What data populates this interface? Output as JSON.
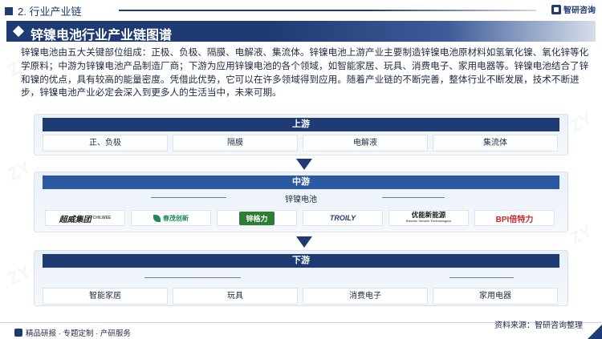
{
  "header": {
    "section": "2. 行业产业链",
    "brand": "智研咨询"
  },
  "title": "锌镍电池行业产业链图谱",
  "paragraph": "锌镍电池由五大关键部位组成：正极、负极、隔膜、电解液、集流体。锌镍电池上游产业主要制造锌镍电池原材料如氢氧化镍、氧化锌等化学原料；中游为锌镍电池产品制造厂商；下游为应用锌镍电池的各个领域，如智能家居、玩具、消费电子、家用电器等。锌镍电池结合了锌和镍的优点，具有较高的能量密度。凭借此优势，它可以在许多领域得到应用。随着产业链的不断完善，整体行业不断发展，技术不断进步，锌镍电池产业必定会深入到更多人的生活当中，未来可期。",
  "upstream": {
    "label": "上游",
    "items": [
      "正、负极",
      "隔膜",
      "电解液",
      "集流体"
    ]
  },
  "midstream": {
    "label": "中游",
    "sub_label": "锌镍电池",
    "companies": [
      {
        "name": "超威集团",
        "sub": "CHILWEE",
        "color": "#222222"
      },
      {
        "name": "春茂创新",
        "sub": "",
        "color": "#1f8a5a"
      },
      {
        "name": "锌格力",
        "sub": "",
        "color": "#ffffff",
        "bg": "#2e7d32"
      },
      {
        "name": "TROILY",
        "sub": "",
        "color": "#1f3b74"
      },
      {
        "name": "优能新能源",
        "sub": "Electric Vehicle Technologies",
        "color": "#222222"
      },
      {
        "name": "BPI倍特力",
        "sub": "",
        "color": "#c62828"
      }
    ]
  },
  "downstream": {
    "label": "下游",
    "items": [
      "智能家居",
      "玩具",
      "消费电子",
      "家用电器"
    ]
  },
  "footer": {
    "left": "精品研报 · 专题定制 · 产研服务",
    "source": "资料来源：智研咨询整理"
  },
  "colors": {
    "primary": "#1f3b74",
    "mid": "#2c5aa0"
  }
}
